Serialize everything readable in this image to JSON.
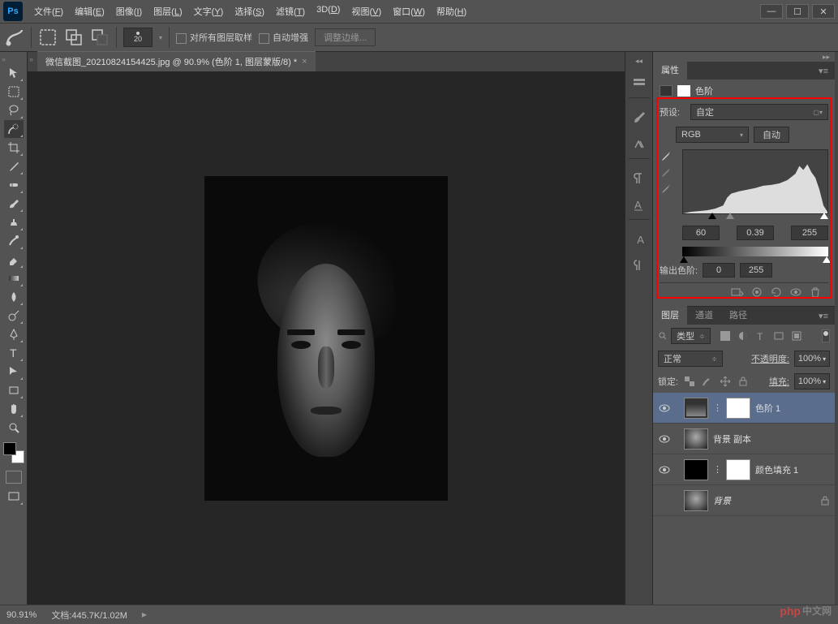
{
  "app": {
    "logo": "Ps"
  },
  "menus": [
    {
      "label": "文件",
      "hot": "F"
    },
    {
      "label": "编辑",
      "hot": "E"
    },
    {
      "label": "图像",
      "hot": "I"
    },
    {
      "label": "图层",
      "hot": "L"
    },
    {
      "label": "文字",
      "hot": "Y"
    },
    {
      "label": "选择",
      "hot": "S"
    },
    {
      "label": "滤镜",
      "hot": "T"
    },
    {
      "label": "3D",
      "hot": "D"
    },
    {
      "label": "视图",
      "hot": "V"
    },
    {
      "label": "窗口",
      "hot": "W"
    },
    {
      "label": "帮助",
      "hot": "H"
    }
  ],
  "options": {
    "brush_size": "20",
    "sample_all": "对所有图层取样",
    "auto_enhance": "自动增强",
    "refine_edge": "调整边缘..."
  },
  "document": {
    "tab": "微信截图_20210824154425.jpg @ 90.9% (色阶 1, 图层蒙版/8) *"
  },
  "properties": {
    "panel_title": "属性",
    "adjustment_name": "色阶",
    "preset_label": "预设:",
    "preset_value": "自定",
    "channel": "RGB",
    "auto_btn": "自动",
    "levels": {
      "black": "60",
      "mid": "0.39",
      "white": "255"
    },
    "output_label": "输出色阶:",
    "output": {
      "black": "0",
      "white": "255"
    }
  },
  "layers_panel": {
    "tabs": [
      "图层",
      "通道",
      "路径"
    ],
    "filter_label": "类型",
    "blend_mode": "正常",
    "opacity_label": "不透明度:",
    "opacity": "100%",
    "lock_label": "锁定:",
    "fill_label": "填充:",
    "fill": "100%",
    "layers": [
      {
        "name": "色阶 1",
        "type": "adjustment",
        "visible": true,
        "selected": true,
        "linked": true,
        "mask": true
      },
      {
        "name": "背景 副本",
        "type": "image",
        "visible": true
      },
      {
        "name": "颜色填充 1",
        "type": "fill",
        "visible": true,
        "mask": true,
        "linked": true
      },
      {
        "name": "背景",
        "type": "bg",
        "visible": false,
        "locked": true
      }
    ]
  },
  "status": {
    "zoom": "90.91%",
    "docinfo": "文档:445.7K/1.02M"
  },
  "watermark": {
    "prefix": "php",
    "suffix": "中文网"
  }
}
